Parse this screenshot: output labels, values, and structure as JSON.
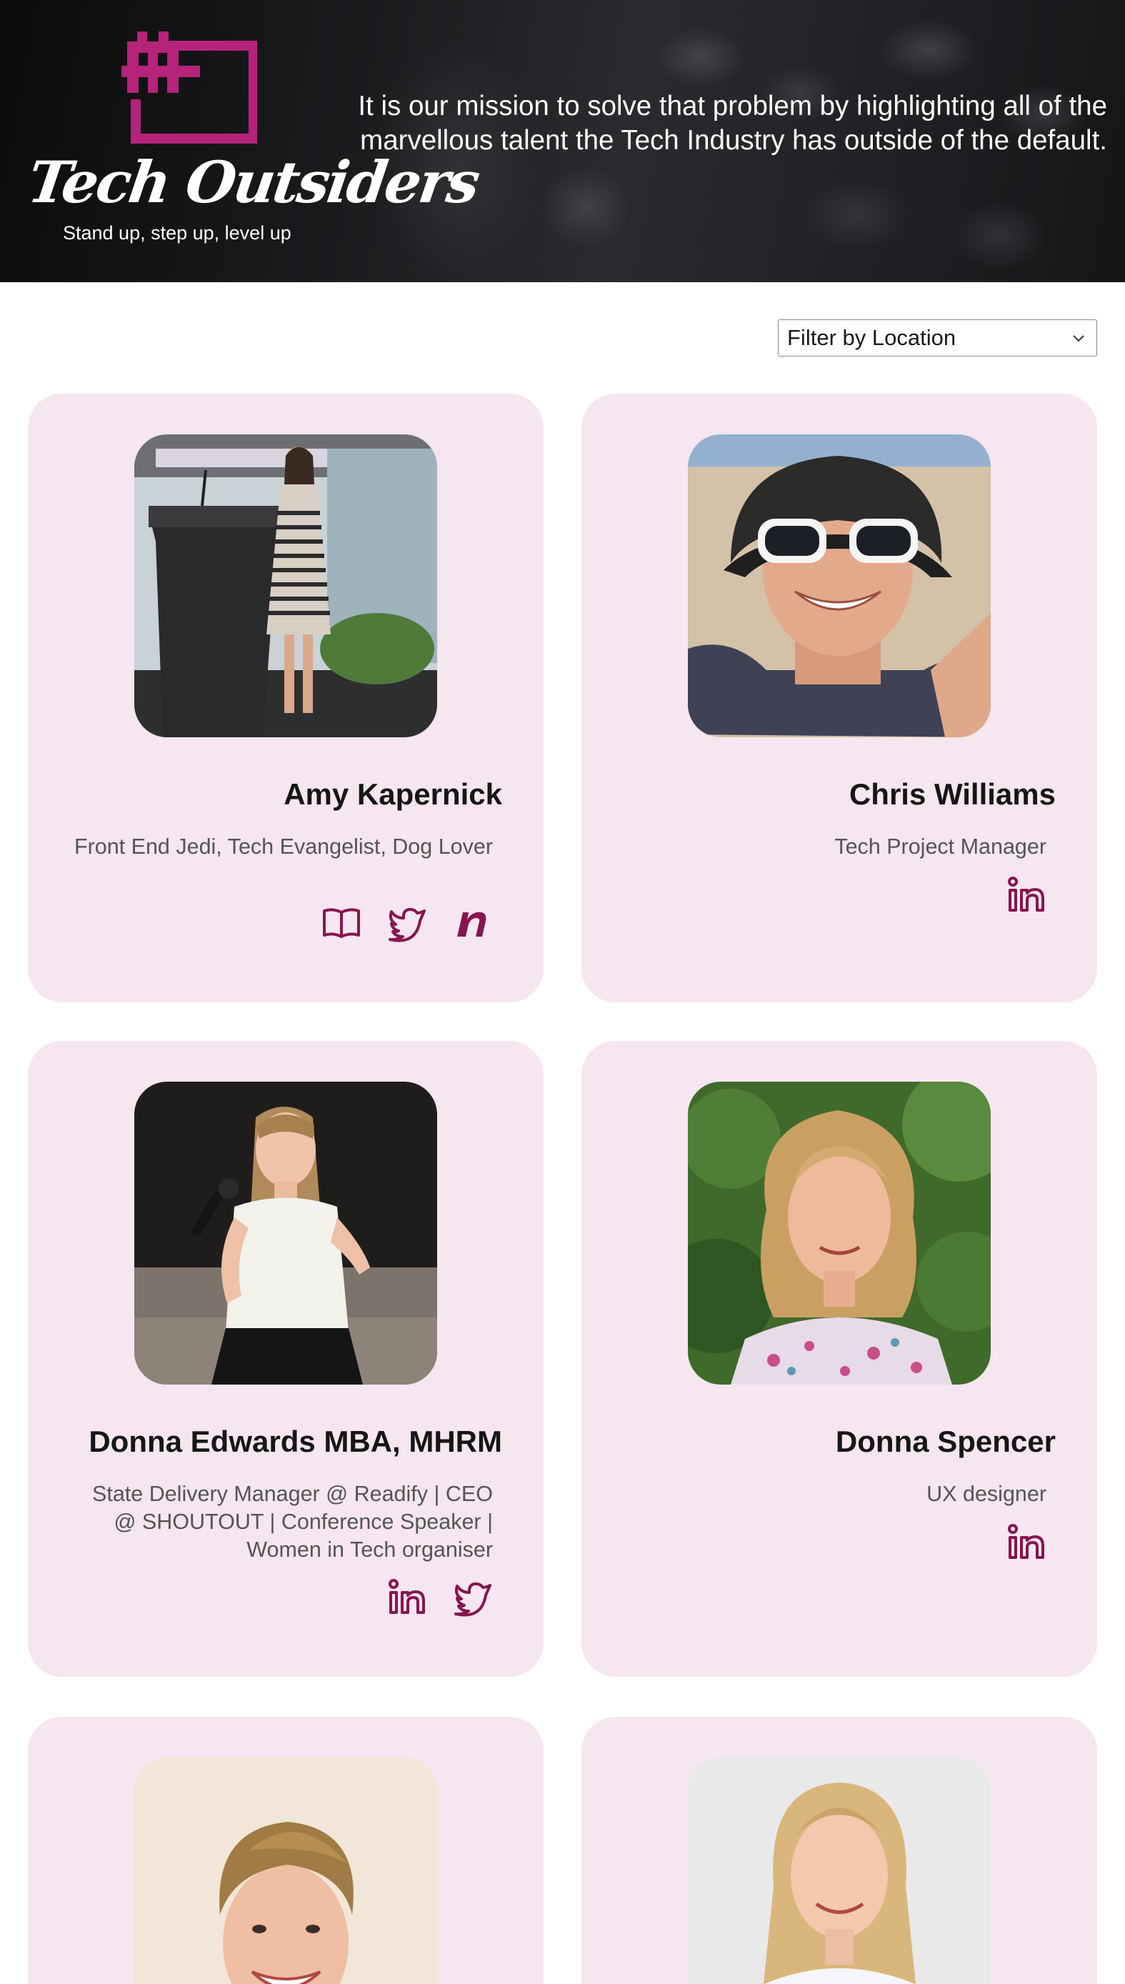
{
  "brand": {
    "name": "Tech Outsiders",
    "tagline": "Stand up, step up, level up",
    "mission": "It is our mission to solve that problem by highlighting all of the marvellous talent the Tech Industry has outside of the default.",
    "accent_color": "#b5237a",
    "icon_color": "#86154f",
    "card_color": "#f5e6ef"
  },
  "filter": {
    "label": "Filter by Location",
    "icon": "chevron-down-icon"
  },
  "profiles": [
    {
      "name": "Amy Kapernick",
      "role": "Front End Jedi, Tech Evangelist, Dog Lover",
      "photo": "speaker-at-podium-photo",
      "socials": [
        "book-icon",
        "twitter-icon",
        "n-blog-icon"
      ]
    },
    {
      "name": "Chris Williams",
      "role": "Tech Project Manager",
      "photo": "selfie-with-sunglasses-photo",
      "socials": [
        "linkedin-icon"
      ]
    },
    {
      "name": "Donna Edwards MBA, MHRM",
      "role": "State Delivery Manager @ Readify | CEO @ SHOUTOUT | Conference Speaker | Women in Tech organiser",
      "photo": "speaker-with-microphone-photo",
      "socials": [
        "linkedin-icon",
        "twitter-icon"
      ]
    },
    {
      "name": "Donna Spencer",
      "role": "UX designer",
      "photo": "portrait-in-garden-photo",
      "socials": [
        "linkedin-icon"
      ]
    },
    {
      "name": "",
      "role": "",
      "photo": "short-hair-portrait-photo",
      "socials": []
    },
    {
      "name": "",
      "role": "",
      "photo": "long-blonde-hair-portrait-photo",
      "socials": []
    }
  ]
}
